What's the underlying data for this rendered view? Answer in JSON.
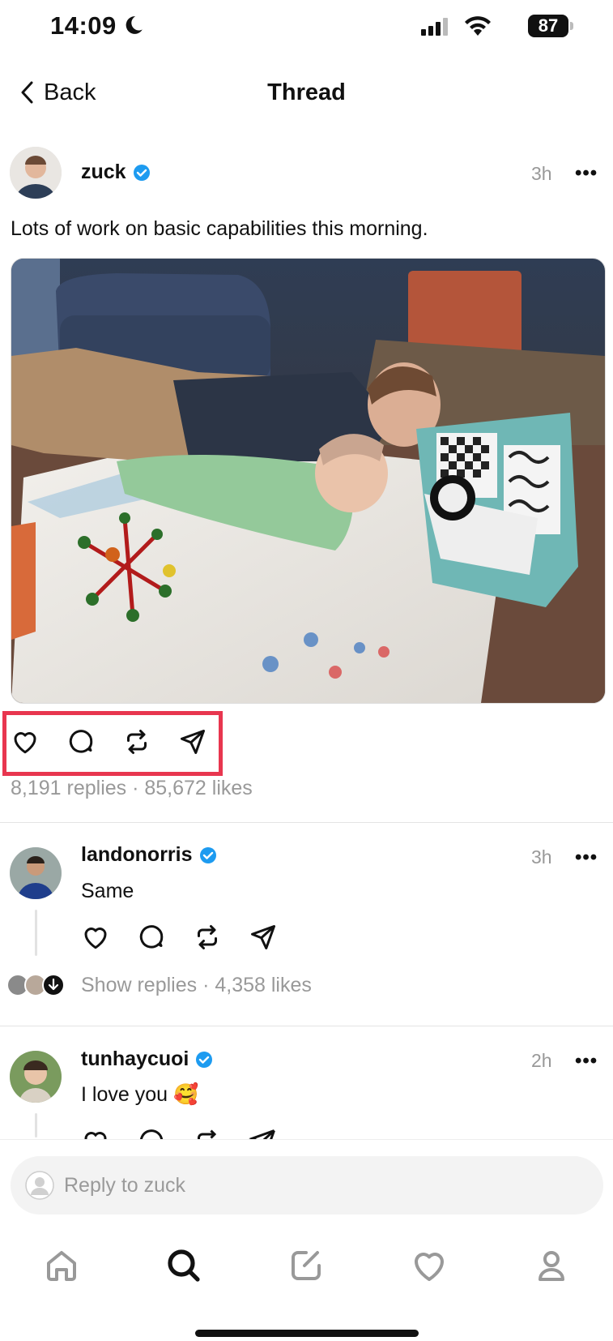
{
  "status_bar": {
    "time": "14:09",
    "battery": "87"
  },
  "header": {
    "back_label": "Back",
    "title": "Thread"
  },
  "main_post": {
    "username": "zuck",
    "time": "3h",
    "more": "•••",
    "text": "Lots of work on basic capabilities this morning.",
    "stats": "8,191 replies · 85,672 likes"
  },
  "replies": [
    {
      "username": "landonorris",
      "time": "3h",
      "more": "•••",
      "text": "Same",
      "stats": "Show replies · 4,358 likes"
    },
    {
      "username": "tunhaycuoi",
      "time": "2h",
      "more": "•••",
      "text": "I love you 🥰"
    }
  ],
  "reply_bar": {
    "placeholder": "Reply to zuck"
  },
  "colors": {
    "verified": "#1d9bf0",
    "highlight": "#e8364f",
    "muted": "#999999"
  },
  "icons": [
    "heart-icon",
    "comment-icon",
    "repost-icon",
    "share-icon",
    "home-icon",
    "search-icon",
    "compose-icon",
    "activity-icon",
    "profile-icon"
  ]
}
